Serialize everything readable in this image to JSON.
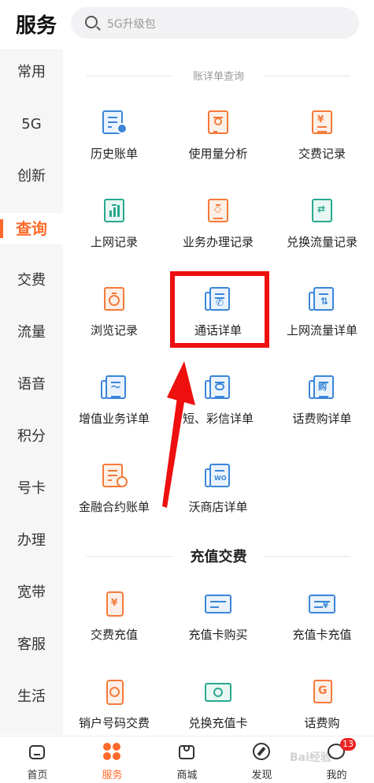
{
  "header": {
    "title": "服务",
    "search_placeholder": "5G升级包"
  },
  "sidebar": {
    "items": [
      {
        "label": "常用"
      },
      {
        "label": "5G"
      },
      {
        "label": "创新"
      },
      {
        "label": "查询",
        "active": true
      },
      {
        "label": "交费"
      },
      {
        "label": "流量"
      },
      {
        "label": "语音"
      },
      {
        "label": "积分"
      },
      {
        "label": "号卡"
      },
      {
        "label": "办理"
      },
      {
        "label": "宽带"
      },
      {
        "label": "客服"
      },
      {
        "label": "生活"
      }
    ]
  },
  "sections": {
    "query_title": "账详单查询",
    "recharge_title": "充值交费"
  },
  "query_items": [
    {
      "label": "历史账单",
      "icon": "history-bill-icon",
      "color": "blue"
    },
    {
      "label": "使用量分析",
      "icon": "usage-analysis-icon",
      "color": "orange"
    },
    {
      "label": "交费记录",
      "icon": "payment-record-icon",
      "color": "orange"
    },
    {
      "label": "上网记录",
      "icon": "internet-record-icon",
      "color": "green"
    },
    {
      "label": "业务办理记录",
      "icon": "business-record-icon",
      "color": "orange"
    },
    {
      "label": "兑换流量记录",
      "icon": "exchange-data-icon",
      "color": "green"
    },
    {
      "label": "浏览记录",
      "icon": "browse-record-icon",
      "color": "orange"
    },
    {
      "label": "通话详单",
      "icon": "call-detail-icon",
      "color": "blue"
    },
    {
      "label": "上网流量详单",
      "icon": "data-detail-icon",
      "color": "blue"
    },
    {
      "label": "增值业务详单",
      "icon": "value-added-icon",
      "color": "blue"
    },
    {
      "label": "短、彩信详单",
      "icon": "sms-detail-icon",
      "color": "blue"
    },
    {
      "label": "话费购详单",
      "icon": "credit-purchase-icon",
      "color": "blue"
    },
    {
      "label": "金融合约账单",
      "icon": "finance-contract-icon",
      "color": "orange"
    },
    {
      "label": "沃商店详单",
      "icon": "wo-store-icon",
      "color": "blue"
    }
  ],
  "recharge_items": [
    {
      "label": "交费充值",
      "icon": "recharge-icon",
      "color": "orange"
    },
    {
      "label": "充值卡购买",
      "icon": "card-purchase-icon",
      "color": "blue"
    },
    {
      "label": "充值卡充值",
      "icon": "card-recharge-icon",
      "color": "blue"
    },
    {
      "label": "销户号码交费",
      "icon": "closed-number-icon",
      "color": "orange"
    },
    {
      "label": "兑换充值卡",
      "icon": "exchange-card-icon",
      "color": "green"
    },
    {
      "label": "话费购",
      "icon": "credit-buy-icon",
      "color": "orange"
    }
  ],
  "tabbar": {
    "items": [
      {
        "label": "首页",
        "icon": "home-icon"
      },
      {
        "label": "服务",
        "icon": "service-icon",
        "active": true
      },
      {
        "label": "商城",
        "icon": "mall-icon"
      },
      {
        "label": "发现",
        "icon": "compass-icon"
      },
      {
        "label": "我的",
        "icon": "profile-icon",
        "badge": "13"
      }
    ]
  },
  "watermark": "Bai经验",
  "colors": {
    "accent": "#ff6a2a",
    "highlight": "#ee0f0f",
    "blue": "#3b86d8",
    "orange": "#f47a3a",
    "green": "#2aa890"
  }
}
